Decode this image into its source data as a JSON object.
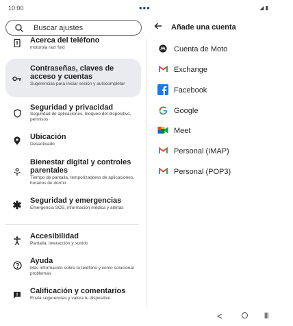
{
  "status": {
    "time": "10:00",
    "dots": "•••",
    "icons": "◢ ▮"
  },
  "search": {
    "placeholder": "Buscar ajustes"
  },
  "settings": [
    {
      "title": "Acerca del teléfono",
      "subtitle": "motorola razr fold",
      "icon": "phone-info-icon"
    },
    {
      "title": "Contraseñas, claves de acceso y cuentas",
      "subtitle": "Sugerencias para iniciar sesión y autocompletar",
      "icon": "key-icon"
    },
    {
      "title": "Seguridad y privacidad",
      "subtitle": "Seguridad de aplicaciones, bloqueo del dispositivo, permisos",
      "icon": "shield-icon"
    },
    {
      "title": "Ubicación",
      "subtitle": "Desactivado",
      "icon": "location-pin-icon"
    },
    {
      "title": "Bienestar digital y controles parentales",
      "subtitle": "Tiempo de pantalla, temporizadores de aplicaciones, horarios de dormir",
      "icon": "wellbeing-icon"
    },
    {
      "title": "Seguridad y emergencias",
      "subtitle": "Emergencia SOS, información médica y alertas",
      "icon": "asterisk-icon"
    },
    {
      "title": "Accesibilidad",
      "subtitle": "Pantalla, interacción y sonido",
      "icon": "accessibility-icon"
    },
    {
      "title": "Ayuda",
      "subtitle": "Más información sobre tu teléfono y cómo solucionar problemas",
      "icon": "help-icon"
    },
    {
      "title": "Calificación y comentarios",
      "subtitle": "Envía sugerencias y valora tu dispositivo",
      "icon": "feedback-icon"
    }
  ],
  "right": {
    "title": "Añade una cuenta",
    "accounts": [
      {
        "label": "Cuenta de Moto",
        "icon": "moto-icon"
      },
      {
        "label": "Exchange",
        "icon": "gmail-icon"
      },
      {
        "label": "Facebook",
        "icon": "facebook-icon"
      },
      {
        "label": "Google",
        "icon": "google-icon"
      },
      {
        "label": "Meet",
        "icon": "meet-icon"
      },
      {
        "label": "Personal (IMAP)",
        "icon": "gmail-icon"
      },
      {
        "label": "Personal (POP3)",
        "icon": "gmail-icon"
      }
    ]
  },
  "nav": {
    "back": "<",
    "recents": "|||"
  },
  "colors": {
    "selected_bg": "#e9ebef",
    "facebook": "#1877f2",
    "gmail_red": "#ea4335"
  }
}
